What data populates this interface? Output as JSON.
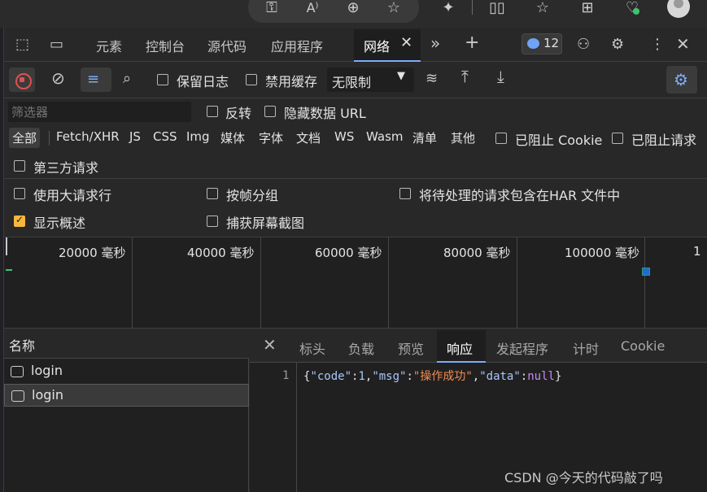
{
  "browser": {
    "icons": [
      "key-icon",
      "read-aloud-icon",
      "zoom-icon",
      "favorite-icon",
      "extensions-icon",
      "split-screen-icon",
      "favorites-icon",
      "collections-icon",
      "health-icon",
      "profile-icon"
    ],
    "read_aloud_glyph": "A⁾"
  },
  "devtools": {
    "tabs": [
      "元素",
      "控制台",
      "源代码",
      "应用程序",
      "网络"
    ],
    "active_tab": "网络",
    "issue_count": "12"
  },
  "network_toolbar": {
    "preserve_log": "保留日志",
    "disable_cache": "禁用缓存",
    "throttling": "无限制"
  },
  "filter": {
    "placeholder": "筛选器",
    "invert": "反转",
    "hide_data_urls": "隐藏数据 URL",
    "types": [
      "全部",
      "Fetch/XHR",
      "JS",
      "CSS",
      "Img",
      "媒体",
      "字体",
      "文档",
      "WS",
      "Wasm",
      "清单",
      "其他"
    ],
    "active_type": "全部",
    "blocked_cookies": "已阻止 Cookie",
    "blocked_requests": "已阻止请求",
    "third_party": "第三方请求"
  },
  "options": {
    "big_rows": "使用大请求行",
    "group_by_frame": "按帧分组",
    "include_pending_har": "将待处理的请求包含在HAR 文件中",
    "show_overview": "显示概述",
    "capture_screenshots": "捕获屏幕截图",
    "show_overview_checked": true
  },
  "overview": {
    "ticks": [
      "20000  毫秒",
      "40000  毫秒",
      "60000  毫秒",
      "80000  毫秒",
      "100000  毫秒",
      "1"
    ]
  },
  "requests": {
    "header": "名称",
    "rows": [
      {
        "name": "login",
        "selected": false
      },
      {
        "name": "login",
        "selected": true
      }
    ]
  },
  "detail": {
    "tabs": [
      "标头",
      "负载",
      "预览",
      "响应",
      "发起程序",
      "计时",
      "Cookie"
    ],
    "active_tab": "响应",
    "line_number": "1",
    "response": {
      "open": "{",
      "k_code": "\"code\"",
      "colon1": ":",
      "v_code": "1",
      "comma1": ",",
      "k_msg": "\"msg\"",
      "colon2": ":",
      "v_msg": "\"操作成功\"",
      "comma2": ",",
      "k_data": "\"data\"",
      "colon3": ":",
      "v_data": "null",
      "close": "}"
    }
  },
  "watermark": "CSDN @今天的代码敲了吗"
}
